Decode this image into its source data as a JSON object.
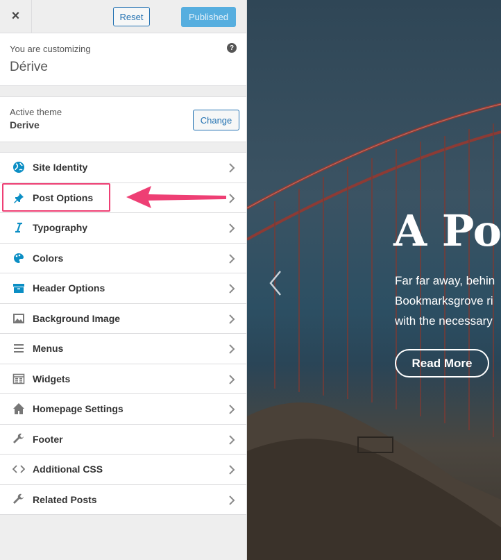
{
  "topbar": {
    "close_label": "×",
    "reset_label": "Reset",
    "publish_label": "Published"
  },
  "info": {
    "label": "You are customizing",
    "site_title": "Dérive",
    "help_icon": "?"
  },
  "theme": {
    "label": "Active theme",
    "name": "Derive",
    "change_label": "Change"
  },
  "menu": {
    "items": [
      {
        "label": "Site Identity",
        "icon": "globe-icon"
      },
      {
        "label": "Post Options",
        "icon": "pin-icon"
      },
      {
        "label": "Typography",
        "icon": "italic-icon"
      },
      {
        "label": "Colors",
        "icon": "palette-icon"
      },
      {
        "label": "Header Options",
        "icon": "archive-icon"
      },
      {
        "label": "Background Image",
        "icon": "image-icon"
      },
      {
        "label": "Menus",
        "icon": "menu-icon"
      },
      {
        "label": "Widgets",
        "icon": "widgets-icon"
      },
      {
        "label": "Homepage Settings",
        "icon": "home-icon"
      },
      {
        "label": "Footer",
        "icon": "wrench-icon"
      },
      {
        "label": "Additional CSS",
        "icon": "code-icon"
      },
      {
        "label": "Related Posts",
        "icon": "wrench-icon"
      }
    ]
  },
  "preview": {
    "title": "A Pos",
    "text_line1": "Far far away, behin",
    "text_line2": "Bookmarksgrove ri",
    "text_line3": "with the necessary",
    "read_more": "Read More"
  },
  "colors": {
    "accent": "#2271b1",
    "highlight": "#ee3f74",
    "icon_blue": "#0b8ec4"
  }
}
